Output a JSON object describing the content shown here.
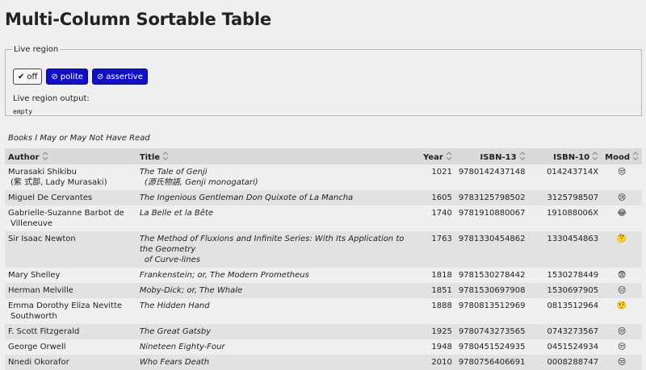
{
  "page": {
    "title": "Multi-Column Sortable Table"
  },
  "live_region": {
    "legend": "Live region",
    "buttons": [
      {
        "glyph": "✔",
        "label": "off",
        "state": "selected"
      },
      {
        "glyph": "⊘",
        "label": "polite",
        "state": "unselected"
      },
      {
        "glyph": "⊘",
        "label": "assertive",
        "state": "unselected"
      }
    ],
    "output_label": "Live region output:",
    "output_value": "empty"
  },
  "table": {
    "caption": "Books I May or May Not Have Read",
    "headers": {
      "author": "Author",
      "title": "Title",
      "year": "Year",
      "isbn13": "ISBN-13",
      "isbn10": "ISBN-10",
      "mood": "Mood"
    },
    "rows": [
      {
        "author": "Murasaki Shikibu",
        "author_sub": "(紫 式部, Lady Murasaki)",
        "title": "The Tale of Genji",
        "title_sub": "(源氏物語, Genji monogatari)",
        "year": "1021",
        "isbn13": "9780142437148",
        "isbn10": "014243714X",
        "mood": "😒"
      },
      {
        "author": "Miguel De Cervantes",
        "author_sub": "",
        "title": "The Ingenious Gentleman Don Quixote of La Mancha",
        "title_sub": "",
        "year": "1605",
        "isbn13": "9783125798502",
        "isbn10": "3125798507",
        "mood": "😢"
      },
      {
        "author": "Gabrielle-Suzanne Barbot de",
        "author_sub": "Villeneuve",
        "title": "La Belle et la Bête",
        "title_sub": "",
        "year": "1740",
        "isbn13": "9781910880067",
        "isbn10": "191088006X",
        "mood": "😂"
      },
      {
        "author": "Sir Isaac Newton",
        "author_sub": "",
        "title": "The Method of Fluxions and Infinite Series: With Its Application to the Geometry",
        "title_sub": "of Curve-lines",
        "year": "1763",
        "isbn13": "9781330454862",
        "isbn10": "1330454863",
        "mood": "🤔"
      },
      {
        "author": "Mary Shelley",
        "author_sub": "",
        "title": "Frankenstein; or, The Modern Prometheus",
        "title_sub": "",
        "year": "1818",
        "isbn13": "9781530278442",
        "isbn10": "1530278449",
        "mood": "😨"
      },
      {
        "author": "Herman Melville",
        "author_sub": "",
        "title": "Moby-Dick; or, The Whale",
        "title_sub": "",
        "year": "1851",
        "isbn13": "9781530697908",
        "isbn10": "1530697905",
        "mood": "😑"
      },
      {
        "author": "Emma Dorothy Eliza Nevitte",
        "author_sub": "Southworth",
        "title": "The Hidden Hand",
        "title_sub": "",
        "year": "1888",
        "isbn13": "9780813512969",
        "isbn10": "0813512964",
        "mood": "🤨"
      },
      {
        "author": "F. Scott Fitzgerald",
        "author_sub": "",
        "title": "The Great Gatsby",
        "title_sub": "",
        "year": "1925",
        "isbn13": "9780743273565",
        "isbn10": "0743273567",
        "mood": "😒"
      },
      {
        "author": "George Orwell",
        "author_sub": "",
        "title": "Nineteen Eighty-Four",
        "title_sub": "",
        "year": "1948",
        "isbn13": "9780451524935",
        "isbn10": "0451524934",
        "mood": "😒"
      },
      {
        "author": "Nnedi Okorafor",
        "author_sub": "",
        "title": "Who Fears Death",
        "title_sub": "",
        "year": "2010",
        "isbn13": "9780756406691",
        "isbn10": "0008288747",
        "mood": "😒"
      }
    ]
  },
  "icons": {
    "sort": "sort-unsorted-icon"
  },
  "colors": {
    "accent_button": "#1010c0",
    "header_bg": "#dadada",
    "stripe_bg": "#e2e2e2",
    "page_bg": "#efefef"
  }
}
